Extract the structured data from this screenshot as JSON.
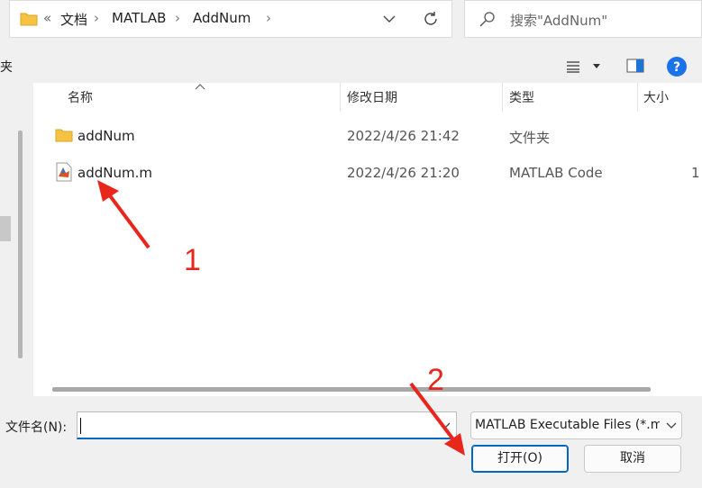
{
  "address_bar": {
    "overflow_label": "«",
    "crumbs": [
      "文档",
      "MATLAB",
      "AddNum"
    ]
  },
  "search": {
    "placeholder": "搜索\"AddNum\""
  },
  "toolbar": {
    "left_fragment": "夹"
  },
  "columns": {
    "name": "名称",
    "date": "修改日期",
    "type": "类型",
    "size": "大小"
  },
  "files": [
    {
      "name": "addNum",
      "date": "2022/4/26 21:42",
      "type": "文件夹",
      "size": "",
      "icon": "folder-icon"
    },
    {
      "name": "addNum.m",
      "date": "2022/4/26 21:20",
      "type": "MATLAB Code",
      "size": "1",
      "icon": "matlab-file-icon"
    }
  ],
  "bottom": {
    "filename_label": "文件名(N):",
    "filename_value": "",
    "filetype_value": "MATLAB Executable Files (*.m",
    "open_button": "打开(O)",
    "cancel_button": "取消"
  },
  "annotations": {
    "label_1": "1",
    "label_2": "2",
    "color": "#e8261c"
  },
  "colors": {
    "accent": "#0067c0",
    "folder": "#f5c242",
    "help": "#1a73e8"
  }
}
